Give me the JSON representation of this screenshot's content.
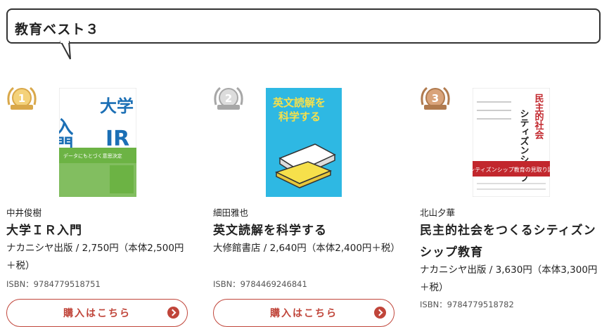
{
  "section": {
    "title": "教育ベスト３"
  },
  "books": [
    {
      "rank": "1",
      "author": "中井俊樹",
      "title": "大学ＩＲ入門",
      "publisher_price": "ナカニシヤ出版 / 2,750円（本体2,500円＋税）",
      "isbn": "ISBN：9784779518751",
      "button_label": "購入はこちら",
      "cover": {
        "title_big": "大学IR",
        "title_side": "入門",
        "band_text": "データにもとづく意思決定のための完全ガイド",
        "colors": {
          "bg": "#ffffff",
          "title": "#1b6fb5",
          "band": "#6cb344"
        }
      }
    },
    {
      "rank": "2",
      "author": "細田雅也",
      "title": "英文読解を科学する",
      "publisher_price": "大修館書店 / 2,640円（本体2,400円＋税）",
      "isbn": "ISBN：9784469246841",
      "button_label": "購入はこちら",
      "cover": {
        "title_line1": "英文読解を",
        "title_line2": "科学する",
        "colors": {
          "bg": "#2eb8e3",
          "title": "#f6e04b"
        }
      }
    },
    {
      "rank": "3",
      "author": "北山夕華",
      "title": "民主的社会をつくるシティズンシップ教育",
      "publisher_price": "ナカニシヤ出版 / 3,630円（本体3,300円＋税）",
      "isbn": "ISBN：9784779518782",
      "button_label": "購入はこちら",
      "cover": {
        "title_main": "民主的社会",
        "title_sub": "シティズンシップ教育",
        "band_text": "シティズンシップ教育の見取り図",
        "colors": {
          "bg": "#ffffff",
          "title": "#c2272d",
          "band": "#c2272d"
        }
      }
    }
  ],
  "colors": {
    "accent": "#c0453a",
    "gold": "#d9a84a",
    "silver": "#a7a7a7",
    "bronze": "#b07a4e"
  }
}
